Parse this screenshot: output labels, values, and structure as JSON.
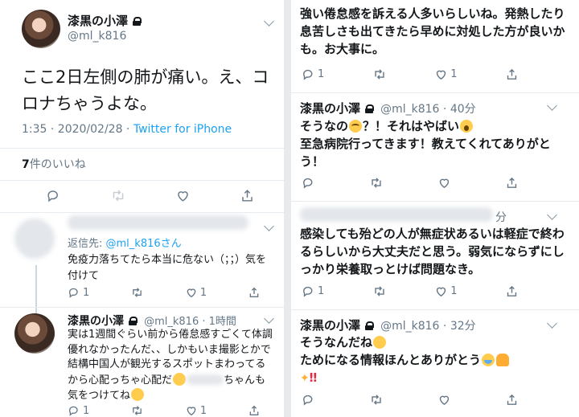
{
  "left": {
    "main_tweet": {
      "name": "漆黒の小澤",
      "handle": "@ml_k816",
      "text": "ここ2日左側の肺が痛い。え、コロナちゃうよな。",
      "meta_time": "1:35 · 2020/02/28 · ",
      "meta_source": "Twitter for iPhone",
      "likes_count": "7",
      "likes_label": "件のいいね"
    },
    "reply1": {
      "reply_to_prefix": "返信先: ",
      "reply_to_handle": "@ml_k816さん",
      "text": "免疫力落ちてたら本当に危ない（；；）気を付けて",
      "replies": "1",
      "likes": "1"
    },
    "reply2": {
      "name": "漆黒の小澤",
      "handle": "@ml_k816 · 1時間",
      "text_a": "実は1週間ぐらい前から倦怠感すごくて体調優れなかったんだ、、しかもいま撮影とかで結構中国人が観光するスポットまわってるから心配っちゃ心配だ",
      "text_b": "ちゃんも気をつけてね",
      "replies": "1",
      "likes": "1"
    }
  },
  "right": {
    "tweet1": {
      "text": "強い倦怠感を訴える人多いらしいね。発熱したり息苦しさも出てきたら早めに対処した方が良いかも。お大事に。",
      "replies": "1",
      "likes": "1"
    },
    "tweet2": {
      "name": "漆黒の小澤",
      "handle": "@ml_k816 · 40分",
      "text_a": "そうなの",
      "text_b": "？！それはやばい",
      "text_c": "至急病院行ってきます！教えてくれてありがとう！"
    },
    "tweet3": {
      "time": "分",
      "text": "感染しても殆どの人が無症状あるいは軽症で終わるらしいから大丈夫だと思う。弱気にならずにしっかり栄養取っとけば問題なき。",
      "replies": "1",
      "likes": "1"
    },
    "tweet4": {
      "name": "漆黒の小澤",
      "handle": "@ml_k816 · 32分",
      "text_a": "そうなんだね",
      "text_b": "ためになる情報ほんとありがとう",
      "bang": "‼"
    }
  }
}
